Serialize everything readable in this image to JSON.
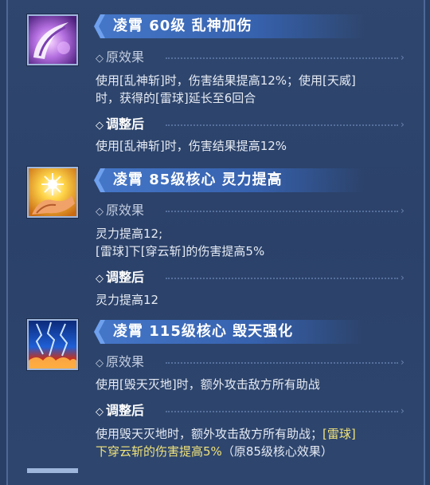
{
  "skills": [
    {
      "title": "凌霄 60级 乱神加伤",
      "icon": "slash-icon",
      "original_label": "原效果",
      "original_lines": [
        "使用[乱神斩]时，伤害结果提高12%；使用[天威]",
        "时，获得的[雷球]延长至6回合"
      ],
      "adjusted_label": "调整后",
      "adjusted_lines": [
        "使用[乱神斩]时，伤害结果提高12%"
      ]
    },
    {
      "title": "凌霄 85级核心 灵力提高",
      "icon": "glowing-hand-icon",
      "original_label": "原效果",
      "original_lines": [
        "灵力提高12;",
        "[雷球]下[穿云斩]的伤害提高5%"
      ],
      "adjusted_label": "调整后",
      "adjusted_lines": [
        "灵力提高12"
      ]
    },
    {
      "title": "凌霄 115级核心 毁天强化",
      "icon": "lightning-fire-icon",
      "original_label": "原效果",
      "original_lines": [
        "使用[毁天灭地]时，额外攻击敌方所有助战"
      ],
      "adjusted_label": "调整后",
      "adjusted_line1_plain": "使用毁天灭地时，额外攻击敌方所有助战；",
      "adjusted_line1_highlight": "[雷球]",
      "adjusted_line2_highlight": "下穿云斩的伤害提高5%",
      "adjusted_line2_plain": "（原85级核心效果）"
    }
  ],
  "colors": {
    "background": "#2a3f66",
    "title_bar": "#4577c9",
    "highlight": "#f1e37a"
  }
}
